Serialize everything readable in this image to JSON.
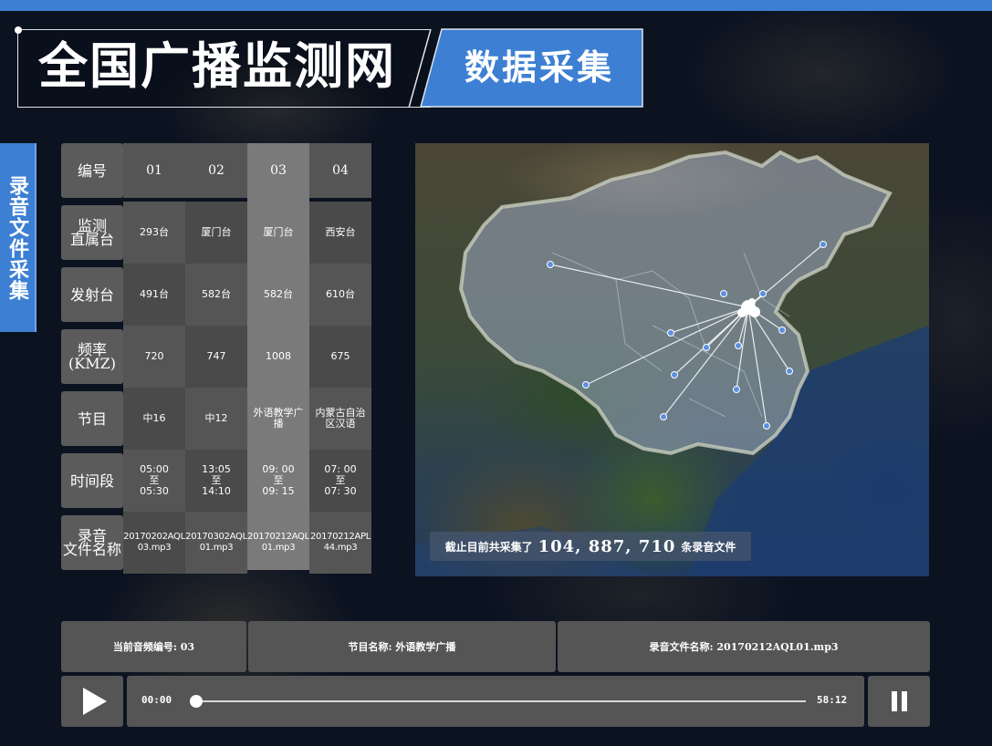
{
  "header": {
    "title": "全国广播监测网",
    "subtitle": "数据采集"
  },
  "side_tab": {
    "label": "录音文件采集"
  },
  "table": {
    "row_headers": [
      "编号",
      "监测\n直属台",
      "发射台",
      "频率\n(KMZ)",
      "节目",
      "时间段",
      "录音\n文件名称"
    ],
    "columns": [
      {
        "id": "01",
        "station": "293台",
        "transmitter": "491台",
        "frequency": "720",
        "program": "中16",
        "time": "05:00\n至\n05:30",
        "file": "20170202AQL\n03.mp3"
      },
      {
        "id": "02",
        "station": "厦门台",
        "transmitter": "582台",
        "frequency": "747",
        "program": "中12",
        "time": "13:05\n至\n14:10",
        "file": "20170302AQL\n01.mp3"
      },
      {
        "id": "03",
        "station": "厦门台",
        "transmitter": "582台",
        "frequency": "1008",
        "program": "外语教学广\n播",
        "time": "09: 00\n至\n09: 15",
        "file": "20170212AQL\n01.mp3"
      },
      {
        "id": "04",
        "station": "西安台",
        "transmitter": "610台",
        "frequency": "675",
        "program": "内蒙古自治\n区汉语",
        "time": "07: 00\n至\n07: 30",
        "file": "20170212APL\n44.mp3"
      }
    ],
    "selected_column": 2
  },
  "map": {
    "caption_prefix": "截止目前共采集了",
    "caption_count": "104, 887, 710",
    "caption_suffix": "条录音文件"
  },
  "player": {
    "current_id_label": "当前音频编号: 03",
    "program_label": "节目名称: 外语教学广播",
    "file_label": "录音文件名称: 20170212AQL01.mp3",
    "time_current": "00:00",
    "time_total": "58:12",
    "progress": 0.0
  },
  "colors": {
    "accent": "#3c7fd1",
    "panel": "#555555",
    "selected_column": "#7a7a7a"
  },
  "icons": {
    "play": "play-icon",
    "pause": "pause-icon"
  }
}
